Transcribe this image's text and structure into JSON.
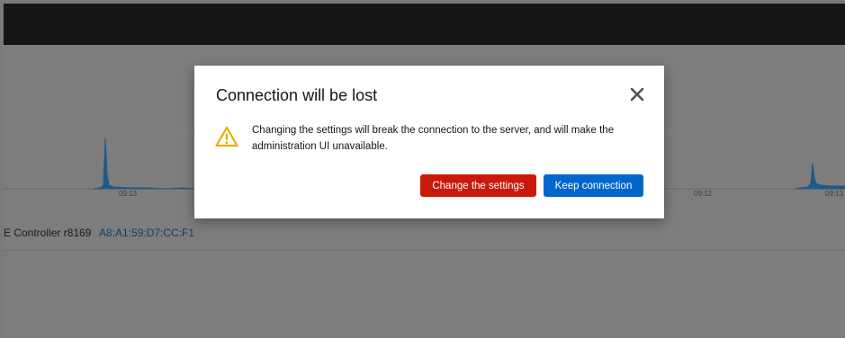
{
  "background": {
    "graph_ticks": [
      "09:13",
      "09:12",
      "09:13"
    ],
    "nic": {
      "name": "E Controller r8169",
      "mac": "A8:A1:59:D7:CC:F1"
    }
  },
  "dialog": {
    "title": "Connection will be lost",
    "message": "Changing the settings will break the connection to the server, and will make the administration UI unavailable.",
    "icons": {
      "close": "close-icon",
      "warning": "warning-icon"
    },
    "buttons": {
      "change_label": "Change the settings",
      "keep_label": "Keep connection"
    }
  },
  "colors": {
    "danger": "#c9190b",
    "primary": "#0066cc",
    "warning": "#f0ab00",
    "overlay": "#7d7d7d",
    "graph": "#1f5a86"
  }
}
